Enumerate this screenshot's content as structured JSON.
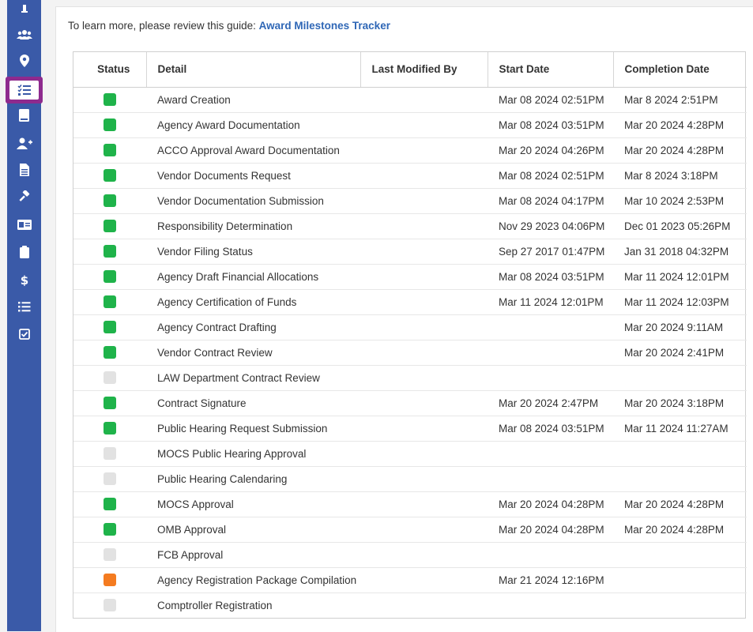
{
  "colors": {
    "sidebar": "#3a5aa8",
    "active_highlight": "#8e2a8e",
    "link": "#2f67b6",
    "status_green": "#1fb34a",
    "status_grey": "#e2e2e2",
    "status_orange": "#f47b20"
  },
  "sidebar": {
    "items": [
      {
        "icon": "info-icon"
      },
      {
        "icon": "users-icon"
      },
      {
        "icon": "map-marker-icon"
      },
      {
        "icon": "task-list-icon",
        "active": true
      },
      {
        "icon": "book-icon"
      },
      {
        "icon": "user-plus-icon"
      },
      {
        "icon": "document-icon"
      },
      {
        "icon": "gavel-icon"
      },
      {
        "icon": "id-card-icon"
      },
      {
        "icon": "clipboard-icon"
      },
      {
        "icon": "dollar-icon"
      },
      {
        "icon": "list-icon"
      },
      {
        "icon": "checkbox-icon"
      }
    ]
  },
  "intro": {
    "text": "To learn more, please review this guide: ",
    "link": "Award Milestones Tracker"
  },
  "table": {
    "headers": [
      "Status",
      "Detail",
      "Last Modified By",
      "Start Date",
      "Completion Date"
    ],
    "rows": [
      {
        "status": "green",
        "detail": "Award Creation",
        "modified_by": "",
        "start": "Mar 08 2024 02:51PM",
        "completion": "Mar 8 2024 2:51PM"
      },
      {
        "status": "green",
        "detail": "Agency Award Documentation",
        "modified_by": "",
        "start": "Mar 08 2024 03:51PM",
        "completion": "Mar 20 2024 4:28PM"
      },
      {
        "status": "green",
        "detail": "ACCO Approval Award Documentation",
        "modified_by": "",
        "start": "Mar 20 2024 04:26PM",
        "completion": "Mar 20 2024 4:28PM"
      },
      {
        "status": "green",
        "detail": "Vendor Documents Request",
        "modified_by": "",
        "start": "Mar 08 2024 02:51PM",
        "completion": "Mar 8 2024 3:18PM"
      },
      {
        "status": "green",
        "detail": "Vendor Documentation Submission",
        "modified_by": "",
        "start": "Mar 08 2024 04:17PM",
        "completion": "Mar 10 2024 2:53PM"
      },
      {
        "status": "green",
        "detail": "Responsibility Determination",
        "modified_by": "",
        "start": "Nov 29 2023 04:06PM",
        "completion": "Dec 01 2023 05:26PM"
      },
      {
        "status": "green",
        "detail": "Vendor Filing Status",
        "modified_by": "",
        "start": "Sep 27 2017 01:47PM",
        "completion": "Jan 31 2018 04:32PM"
      },
      {
        "status": "green",
        "detail": "Agency Draft Financial Allocations",
        "modified_by": "",
        "start": "Mar 08 2024 03:51PM",
        "completion": "Mar 11 2024 12:01PM"
      },
      {
        "status": "green",
        "detail": "Agency Certification of Funds",
        "modified_by": "",
        "start": "Mar 11 2024 12:01PM",
        "completion": "Mar 11 2024 12:03PM"
      },
      {
        "status": "green",
        "detail": "Agency Contract Drafting",
        "modified_by": "",
        "start": "",
        "completion": "Mar 20 2024 9:11AM"
      },
      {
        "status": "green",
        "detail": "Vendor Contract Review",
        "modified_by": "",
        "start": "",
        "completion": "Mar 20 2024 2:41PM"
      },
      {
        "status": "grey",
        "detail": "LAW Department Contract Review",
        "modified_by": "",
        "start": "",
        "completion": ""
      },
      {
        "status": "green",
        "detail": "Contract Signature",
        "modified_by": "",
        "start": "Mar 20 2024 2:47PM",
        "completion": "Mar 20 2024 3:18PM"
      },
      {
        "status": "green",
        "detail": "Public Hearing Request Submission",
        "modified_by": "",
        "start": "Mar 08 2024 03:51PM",
        "completion": "Mar 11 2024 11:27AM"
      },
      {
        "status": "grey",
        "detail": "MOCS Public Hearing Approval",
        "modified_by": "",
        "start": "",
        "completion": ""
      },
      {
        "status": "grey",
        "detail": "Public Hearing Calendaring",
        "modified_by": "",
        "start": "",
        "completion": ""
      },
      {
        "status": "green",
        "detail": "MOCS Approval",
        "modified_by": "",
        "start": "Mar 20 2024 04:28PM",
        "completion": "Mar 20 2024 4:28PM"
      },
      {
        "status": "green",
        "detail": "OMB Approval",
        "modified_by": "",
        "start": "Mar 20 2024 04:28PM",
        "completion": "Mar 20 2024 4:28PM"
      },
      {
        "status": "grey",
        "detail": "FCB Approval",
        "modified_by": "",
        "start": "",
        "completion": ""
      },
      {
        "status": "orange",
        "detail": "Agency Registration Package Compilation",
        "modified_by": "",
        "start": "Mar 21 2024 12:16PM",
        "completion": ""
      },
      {
        "status": "grey",
        "detail": "Comptroller Registration",
        "modified_by": "",
        "start": "",
        "completion": ""
      }
    ]
  }
}
